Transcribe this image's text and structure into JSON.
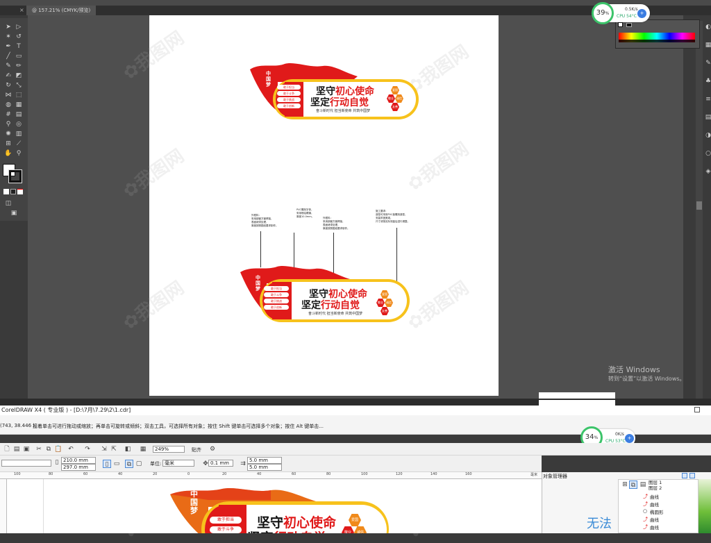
{
  "illustrator": {
    "tab_title": "@ 157.21% (CMYK/预览)",
    "tab_close": "×"
  },
  "perf_top": {
    "percent": "39",
    "percent_unit": "%",
    "net_speed": "0.5K/s",
    "cpu": "CPU 54°C",
    "badge": "+"
  },
  "perf_bottom": {
    "percent": "34",
    "percent_unit": "%",
    "net_speed": "0K/s",
    "cpu": "CPU 53°C",
    "badge": "+"
  },
  "windows_activation": {
    "line1": "激活 Windows",
    "line2": "转到“设置”以激活 Windows。"
  },
  "signboard": {
    "badge_vertical": "中国梦",
    "buttons": [
      "敢于担当",
      "敢于斗争",
      "敢于挑战",
      "敢于创新"
    ],
    "headline_part1_black": "坚守",
    "headline_part1_red": "初心使命",
    "headline_part2_black": "坚定",
    "headline_part2_red": "行动自觉",
    "subtitle": "奋斗新时代 担当新使命 共筑中国梦",
    "hex_labels": [
      "爱国",
      "敬业",
      "诚信",
      "友善"
    ]
  },
  "annotations": [
    "外框料：\n采用钢管方管焊接，\n表面烤漆处理，\n厚度按照图纸要求制作。",
    "PVC雕刻字体，\n采用喷绘覆膜，\n厚度10.0mm。",
    "外框料：\n采用钢管方管焊接，\n表面烤漆处理，\n厚度按照图纸要求制作。",
    "施工要求：\n造型可采用PVC板雕刻造型，\n安装牢固美观，\n尺寸请按实际测量后进行调整。"
  ],
  "coreldraw": {
    "title": "CorelDRAW X4 ( 专业版 ) - [D:\\7月\\7.29\\2\\1.cdr]",
    "coords": "(743, 38.446 )",
    "hint": "接着单击可进行拖动或缩放；再单击可旋转或倾斜；双击工具，可选择所有对象；按住 Shift 键单击可选择多个对象；按住 Alt 键单击...",
    "zoom": "249%",
    "snap_label": "贴齐",
    "width": "210.0 mm",
    "height": "297.0 mm",
    "unit_label": "单位:",
    "unit_value": "毫米",
    "nudge": "0.1 mm",
    "dup_x": "5.0 mm",
    "dup_y": "5.0 mm",
    "ruler_unit": "毫米",
    "ruler_ticks": [
      "100",
      "80",
      "60",
      "40",
      "20",
      "0",
      "20",
      "40",
      "60",
      "80",
      "100",
      "120",
      "140",
      "160"
    ],
    "object_manager": {
      "title": "对象管理器",
      "layers": [
        "图层 1",
        "图层 2"
      ],
      "rows": [
        "曲线",
        "曲线",
        "椭圆形",
        "曲线",
        "曲线"
      ]
    },
    "big_text": "无法"
  },
  "colors": {
    "red": "#e01a1a",
    "yellow": "#f7c21c",
    "orange": "#f08a1b",
    "perf_green": "#3cc46a"
  }
}
